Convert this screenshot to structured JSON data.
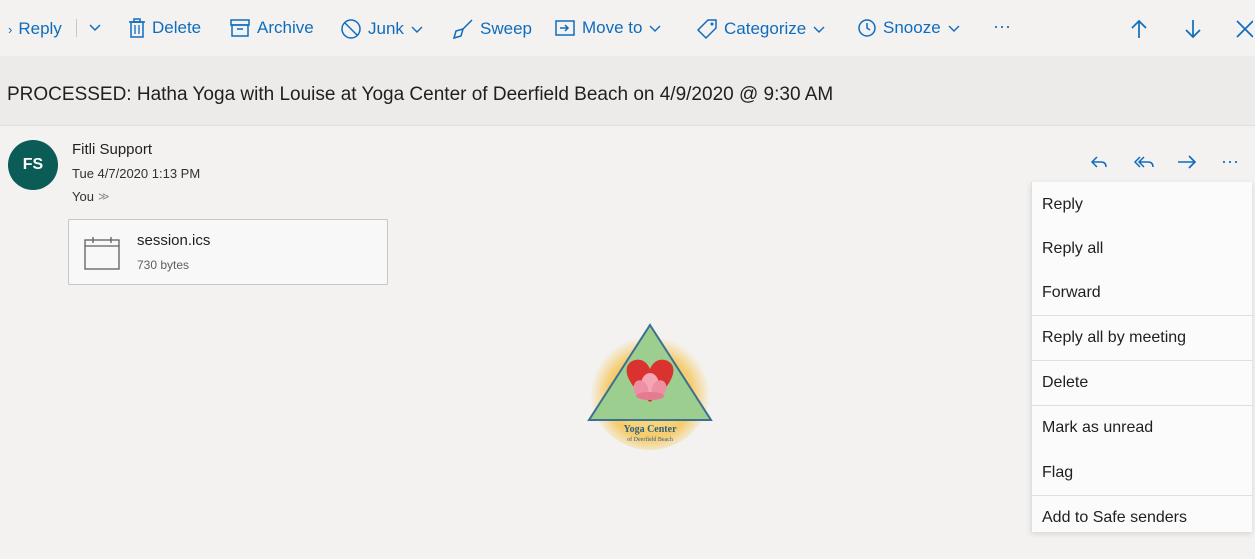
{
  "toolbar": {
    "reply": "Reply",
    "delete": "Delete",
    "archive": "Archive",
    "junk": "Junk",
    "sweep": "Sweep",
    "move_to": "Move to",
    "categorize": "Categorize",
    "snooze": "Snooze",
    "more": "···"
  },
  "subject": "PROCESSED: Hatha Yoga with Louise at Yoga Center of Deerfield Beach on 4/9/2020 @ 9:30 AM",
  "message": {
    "avatar_initials": "FS",
    "sender": "Fitli Support",
    "date": "Tue 4/7/2020 1:13 PM",
    "to": "You"
  },
  "attachment": {
    "name": "session.ics",
    "size": "730 bytes"
  },
  "logo": {
    "line1": "Yoga Center",
    "line2": "of Deerfield Beach"
  },
  "context_menu": {
    "items": [
      "Reply",
      "Reply all",
      "Forward",
      "Reply all by meeting",
      "Delete",
      "Mark as unread",
      "Flag",
      "Add to Safe senders"
    ]
  },
  "colors": {
    "accent": "#0f6cbd",
    "avatar_bg": "#0b5b56"
  }
}
